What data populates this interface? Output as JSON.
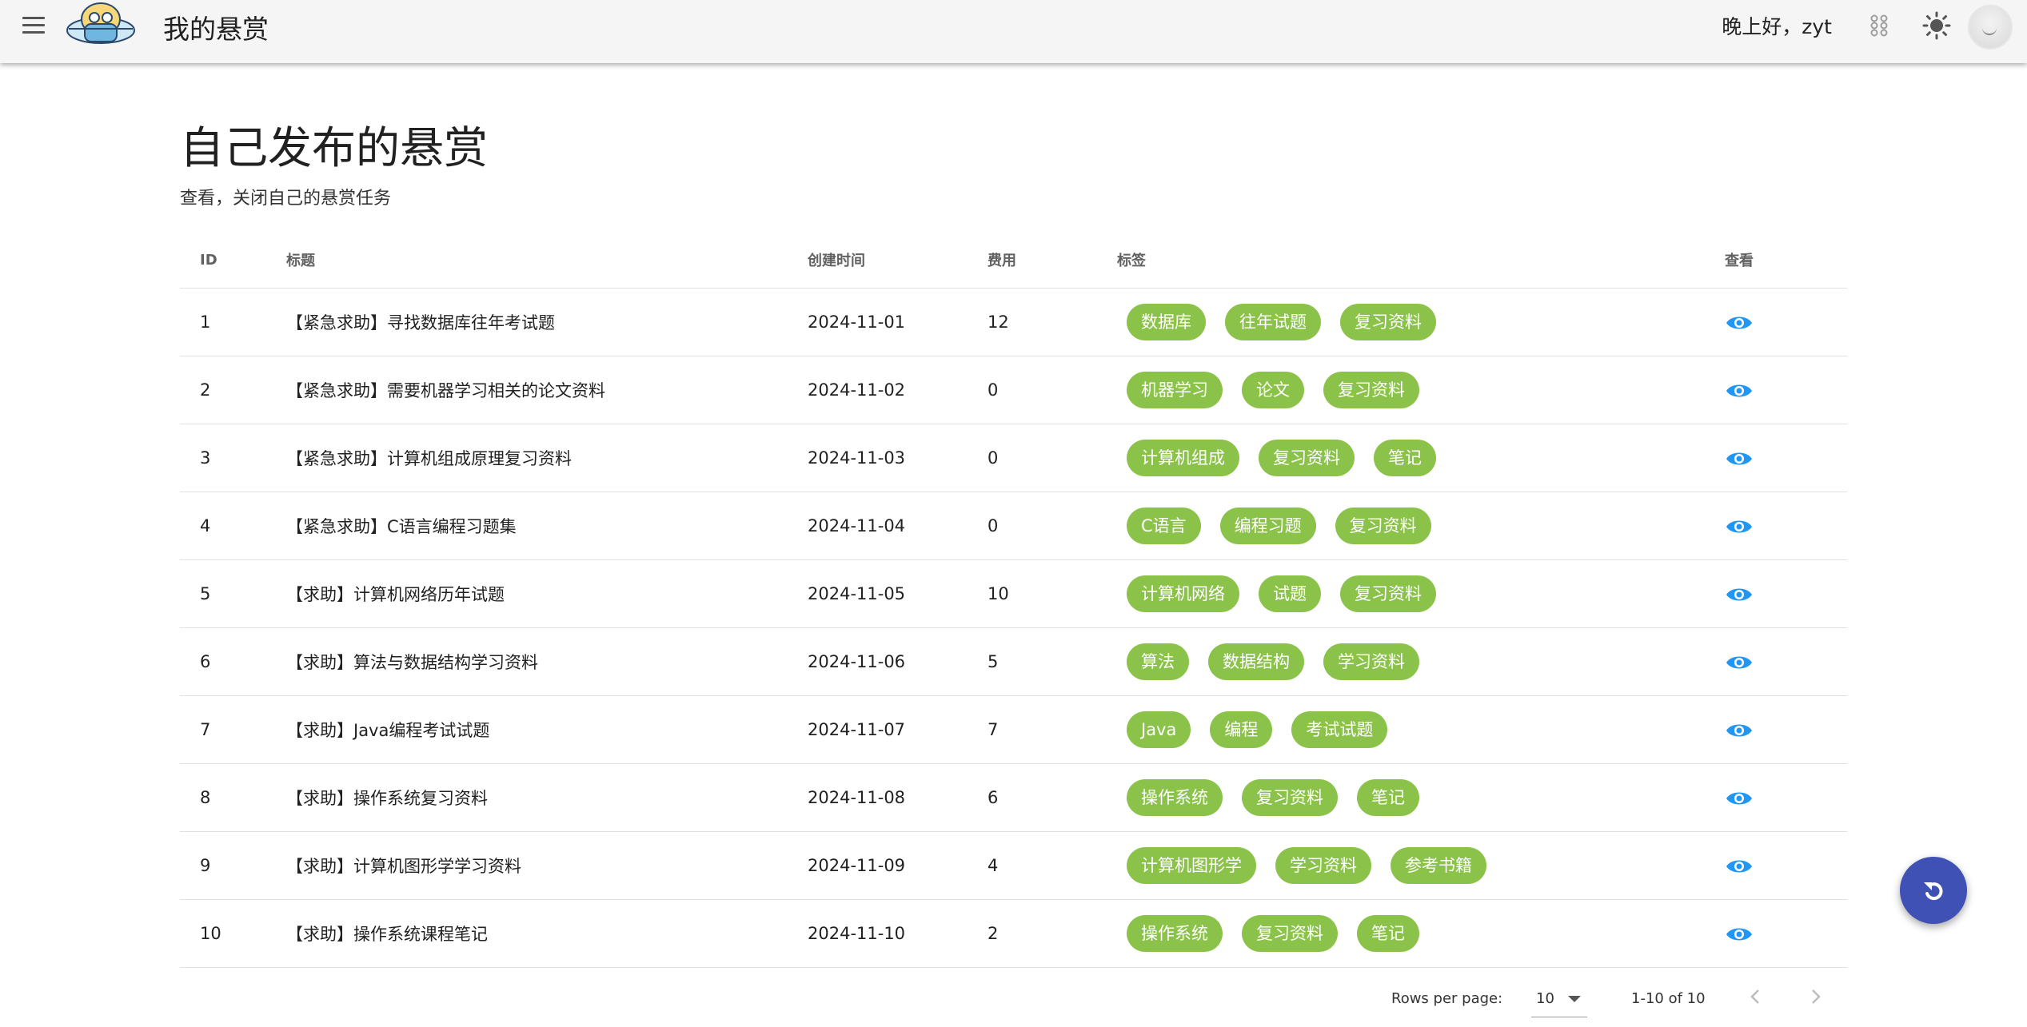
{
  "appbar": {
    "title": "我的悬赏",
    "greeting": "晚上好，zyt",
    "icons": [
      "menu-icon",
      "logo",
      "cheese-connect-icon",
      "brightness-icon",
      "avatar"
    ]
  },
  "page": {
    "title": "自己发布的悬赏",
    "subtitle": "查看，关闭自己的悬赏任务"
  },
  "table": {
    "headers": {
      "id": "ID",
      "title": "标题",
      "created": "创建时间",
      "fee": "费用",
      "tags": "标签",
      "view": "查看"
    },
    "rows": [
      {
        "id": "1",
        "title": "【紧急求助】寻找数据库往年考试题",
        "created": "2024-11-01",
        "fee": "12",
        "tags": [
          "数据库",
          "往年试题",
          "复习资料"
        ]
      },
      {
        "id": "2",
        "title": "【紧急求助】需要机器学习相关的论文资料",
        "created": "2024-11-02",
        "fee": "0",
        "tags": [
          "机器学习",
          "论文",
          "复习资料"
        ]
      },
      {
        "id": "3",
        "title": "【紧急求助】计算机组成原理复习资料",
        "created": "2024-11-03",
        "fee": "0",
        "tags": [
          "计算机组成",
          "复习资料",
          "笔记"
        ]
      },
      {
        "id": "4",
        "title": "【紧急求助】C语言编程习题集",
        "created": "2024-11-04",
        "fee": "0",
        "tags": [
          "C语言",
          "编程习题",
          "复习资料"
        ]
      },
      {
        "id": "5",
        "title": "【求助】计算机网络历年试题",
        "created": "2024-11-05",
        "fee": "10",
        "tags": [
          "计算机网络",
          "试题",
          "复习资料"
        ]
      },
      {
        "id": "6",
        "title": "【求助】算法与数据结构学习资料",
        "created": "2024-11-06",
        "fee": "5",
        "tags": [
          "算法",
          "数据结构",
          "学习资料"
        ]
      },
      {
        "id": "7",
        "title": "【求助】Java编程考试试题",
        "created": "2024-11-07",
        "fee": "7",
        "tags": [
          "Java",
          "编程",
          "考试试题"
        ]
      },
      {
        "id": "8",
        "title": "【求助】操作系统复习资料",
        "created": "2024-11-08",
        "fee": "6",
        "tags": [
          "操作系统",
          "复习资料",
          "笔记"
        ]
      },
      {
        "id": "9",
        "title": "【求助】计算机图形学学习资料",
        "created": "2024-11-09",
        "fee": "4",
        "tags": [
          "计算机图形学",
          "学习资料",
          "参考书籍"
        ]
      },
      {
        "id": "10",
        "title": "【求助】操作系统课程笔记",
        "created": "2024-11-10",
        "fee": "2",
        "tags": [
          "操作系统",
          "复习资料",
          "笔记"
        ]
      }
    ]
  },
  "footer": {
    "rows_per_page_label": "Rows per page:",
    "rows_per_page_value": "10",
    "range": "1-10 of 10"
  },
  "colors": {
    "appbar_bg": "#f5f5f5",
    "chip": "#8bc34a",
    "eye_icon": "#2196f3",
    "fab": "#3f51b5"
  }
}
